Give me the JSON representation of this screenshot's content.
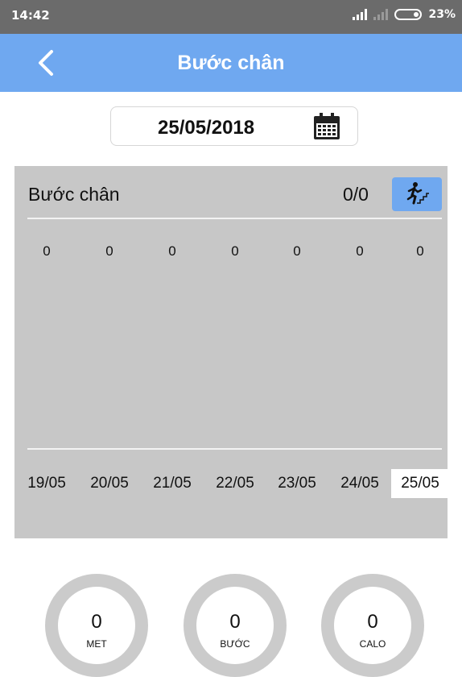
{
  "status_bar": {
    "time": "14:42",
    "battery": "23%"
  },
  "header": {
    "title": "Bước chân",
    "back_icon": "chevron-left-icon"
  },
  "date_picker": {
    "date": "25/05/2018",
    "icon": "calendar-icon"
  },
  "chart": {
    "label": "Bước chân",
    "count": "0/0",
    "mode_icon": "running-stairs-icon",
    "values": [
      "0",
      "0",
      "0",
      "0",
      "0",
      "0",
      "0"
    ],
    "days": [
      "19/05",
      "20/05",
      "21/05",
      "22/05",
      "23/05",
      "24/05",
      "25/05"
    ],
    "selected_day_index": 6
  },
  "chart_data": {
    "type": "bar",
    "categories": [
      "19/05",
      "20/05",
      "21/05",
      "22/05",
      "23/05",
      "24/05",
      "25/05"
    ],
    "values": [
      0,
      0,
      0,
      0,
      0,
      0,
      0
    ]
  },
  "stats": [
    {
      "value": "0",
      "unit": "MET"
    },
    {
      "value": "0",
      "unit": "BƯỚC"
    },
    {
      "value": "0",
      "unit": "CALO"
    }
  ],
  "colors": {
    "accent": "#6fa8f0",
    "panel": "#c7c7c7",
    "status_bar": "#6b6b6b"
  }
}
